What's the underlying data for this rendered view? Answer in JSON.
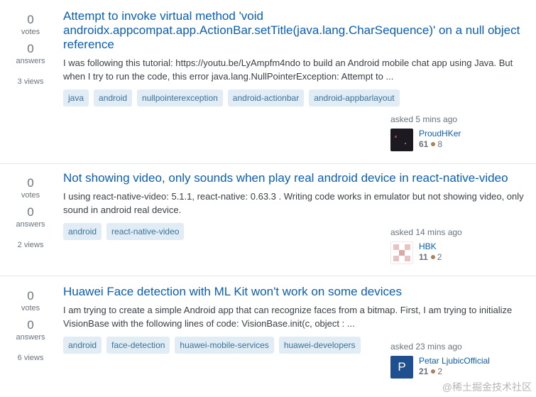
{
  "questions": [
    {
      "votes": "0",
      "votes_label": "votes",
      "answers": "0",
      "answers_label": "answers",
      "views": "3 views",
      "title": "Attempt to invoke virtual method 'void androidx.appcompat.app.ActionBar.setTitle(java.lang.CharSequence)' on a null object reference",
      "excerpt": "I was following this tutorial: https://youtu.be/LyAmpfm4ndo to build an Android mobile chat app using Java. But when I try to run the code, this error java.lang.NullPointerException: Attempt to ...",
      "tags": [
        "java",
        "android",
        "nullpointerexception",
        "android-actionbar",
        "android-appbarlayout"
      ],
      "asked": "asked 5 mins ago",
      "user": "ProudHKer",
      "rep": "61",
      "badge": "8",
      "avatar_style": "dark"
    },
    {
      "votes": "0",
      "votes_label": "votes",
      "answers": "0",
      "answers_label": "answers",
      "views": "2 views",
      "title": "Not showing video, only sounds when play real android device in react-native-video",
      "excerpt": "I using react-native-video: 5.1.1, react-native: 0.63.3 . Writing code works in emulator but not showing video, only sound in android real device.",
      "tags": [
        "android",
        "react-native-video"
      ],
      "asked": "asked 14 mins ago",
      "user": "HBK",
      "rep": "11",
      "badge": "2",
      "avatar_style": "identicon"
    },
    {
      "votes": "0",
      "votes_label": "votes",
      "answers": "0",
      "answers_label": "answers",
      "views": "6 views",
      "title": "Huawei Face detection with ML Kit won't work on some devices",
      "excerpt": "I am trying to create a simple Android app that can recognize faces from a bitmap. First, I am trying to initialize VisionBase with the following lines of code: VisionBase.init(c, object : ...",
      "tags": [
        "android",
        "face-detection",
        "huawei-mobile-services",
        "huawei-developers"
      ],
      "asked": "asked 23 mins ago",
      "user": "Petar LjubicOfficial",
      "rep": "21",
      "badge": "2",
      "avatar_letter": "P",
      "avatar_style": "letter"
    }
  ],
  "watermark": "@稀土掘金技术社区",
  "colors": {
    "link": "#0a5fb3",
    "tag_bg": "#e1ecf4",
    "tag_text": "#39739d",
    "bronze": "#ab825f"
  }
}
